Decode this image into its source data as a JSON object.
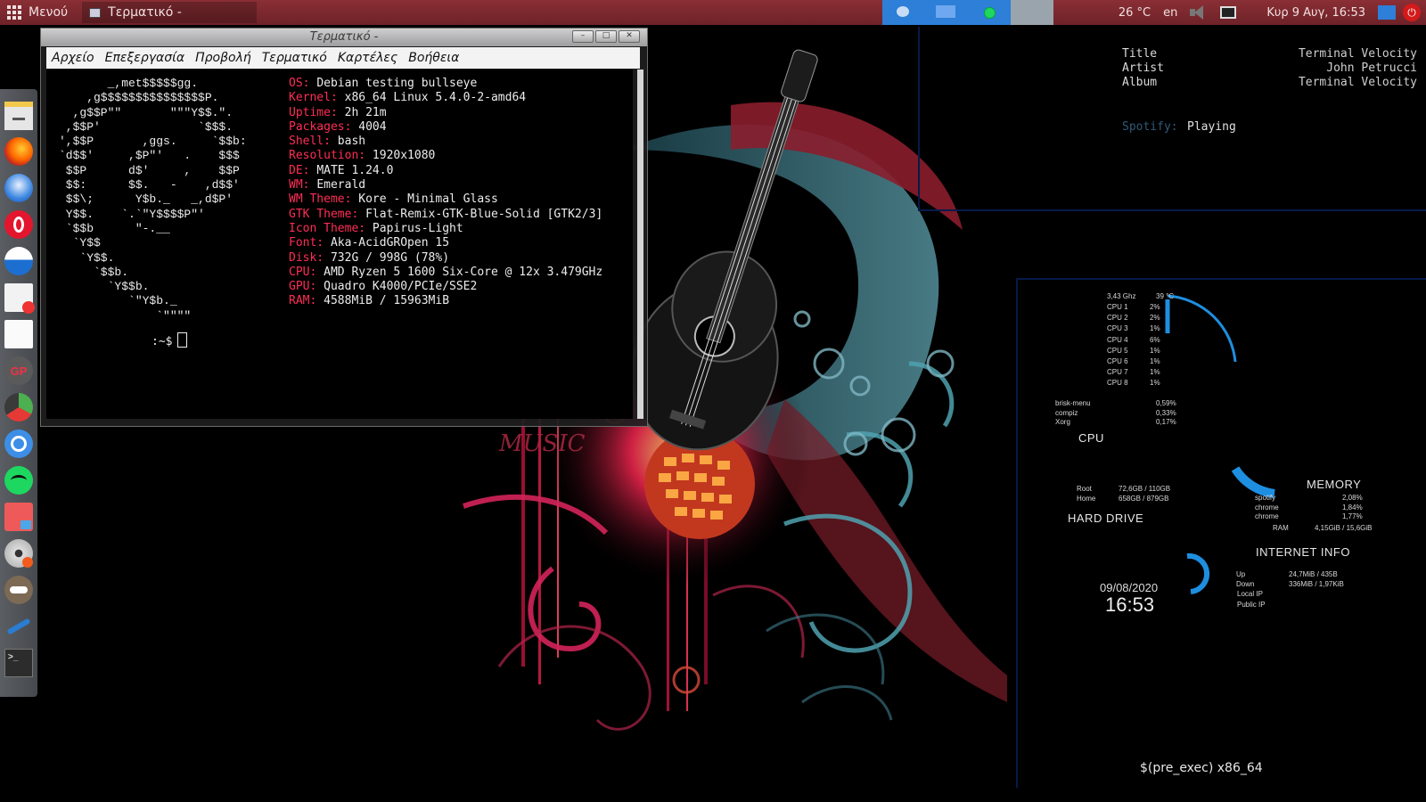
{
  "top_panel": {
    "menu_label": "Μενού",
    "task_title": "Τερματικό -",
    "weather": "26 °C",
    "language": "en",
    "datetime": "Κυρ 9 Αυγ, 16:53",
    "power_glyph": "⏻"
  },
  "dock": {
    "terminal_glyph": ">_",
    "gp_label": "GP"
  },
  "terminal": {
    "title": "Τερματικό -",
    "window_buttons": [
      "–",
      "□",
      "✕"
    ],
    "menu": [
      "Αρχείο",
      "Επεξεργασία",
      "Προβολή",
      "Τερματικό",
      "Καρτέλες",
      "Βοήθεια"
    ],
    "ascii_art": "       _,met$$$$$gg.\n    ,g$$$$$$$$$$$$$$$P.\n  ,g$$P\"\"       \"\"\"Y$$.\".\n ,$$P'              `$$$.\n',$$P       ,ggs.     `$$b:\n`d$$'     ,$P\"'   .    $$$\n $$P      d$'     ,    $$P\n $$:      $$.   -    ,d$$'\n $$\\;      Y$b._   _,d$P'\n Y$$.    `.`\"Y$$$$P\"'\n `$$b      \"-.__\n  `Y$$\n   `Y$$.\n     `$$b.\n       `Y$$b.\n          `\"Y$b._\n              `\"\"\"\"",
    "neofetch": [
      {
        "key": "OS:",
        "value": "Debian testing bullseye"
      },
      {
        "key": "Kernel:",
        "value": "x86_64 Linux 5.4.0-2-amd64"
      },
      {
        "key": "Uptime:",
        "value": "2h 21m"
      },
      {
        "key": "Packages:",
        "value": "4004"
      },
      {
        "key": "Shell:",
        "value": "bash"
      },
      {
        "key": "Resolution:",
        "value": "1920x1080"
      },
      {
        "key": "DE:",
        "value": "MATE 1.24.0"
      },
      {
        "key": "WM:",
        "value": "Emerald"
      },
      {
        "key": "WM Theme:",
        "value": "Kore - Minimal Glass"
      },
      {
        "key": "GTK Theme:",
        "value": "Flat-Remix-GTK-Blue-Solid [GTK2/3]"
      },
      {
        "key": "Icon Theme:",
        "value": "Papirus-Light"
      },
      {
        "key": "Font:",
        "value": "Aka-AcidGROpen 15"
      },
      {
        "key": "Disk:",
        "value": "732G / 998G (78%)"
      },
      {
        "key": "CPU:",
        "value": "AMD Ryzen 5 1600 Six-Core @ 12x 3.479GHz"
      },
      {
        "key": "GPU:",
        "value": "Quadro K4000/PCIe/SSE2"
      },
      {
        "key": "RAM:",
        "value": "4588MiB / 15963MiB"
      }
    ],
    "prompt": ":~$"
  },
  "music": {
    "labels": {
      "title": "Title",
      "artist": "Artist",
      "album": "Album"
    },
    "title": "Terminal Velocity",
    "artist": "John Petrucci",
    "album": "Terminal Velocity",
    "spotify_label": "Spotify:",
    "spotify_status": "Playing"
  },
  "system": {
    "cpu_freq": "3,43 Ghz",
    "cpu_temp": "39 °C",
    "cpus": [
      {
        "name": "CPU 1",
        "usage": "2%"
      },
      {
        "name": "CPU 2",
        "usage": "2%"
      },
      {
        "name": "CPU 3",
        "usage": "1%"
      },
      {
        "name": "CPU 4",
        "usage": "6%"
      },
      {
        "name": "CPU 5",
        "usage": "1%"
      },
      {
        "name": "CPU 6",
        "usage": "1%"
      },
      {
        "name": "CPU 7",
        "usage": "1%"
      },
      {
        "name": "CPU 8",
        "usage": "1%"
      }
    ],
    "cpu_processes": [
      {
        "name": "brisk-menu",
        "value": "0,59%"
      },
      {
        "name": "compiz",
        "value": "0,33%"
      },
      {
        "name": "Xorg",
        "value": "0,17%"
      }
    ],
    "cpu_label": "CPU",
    "memory_label": "MEMORY",
    "mem_processes": [
      {
        "name": "spotify",
        "value": "2,08%"
      },
      {
        "name": "chrome",
        "value": "1,84%"
      },
      {
        "name": "chrome",
        "value": "1,77%"
      }
    ],
    "ram_label": "RAM",
    "ram_value": "4,15GiB / 15,6GiB",
    "disks": [
      {
        "name": "Root",
        "value": "72,6GB / 110GB"
      },
      {
        "name": "Home",
        "value": "658GB / 879GB"
      }
    ],
    "hard_drive_label": "HARD DRIVE",
    "internet_label": "INTERNET INFO",
    "net": [
      {
        "name": "Up",
        "value": "24,7MiB / 435B"
      },
      {
        "name": "Down",
        "value": "336MiB / 1,97KiB"
      }
    ],
    "local_ip_label": "Local IP",
    "public_ip_label": "Public IP",
    "date": "09/08/2020",
    "time": "16:53",
    "pre_exec": "$(pre_exec) x86_64"
  },
  "colors": {
    "panel": "#7a2a30",
    "accent_blue": "#1e8fe0",
    "neofetch_key": "#ff2d55"
  }
}
